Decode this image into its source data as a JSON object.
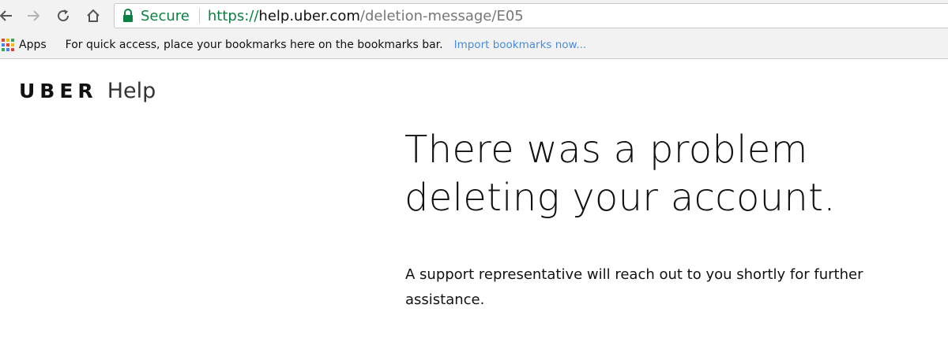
{
  "browser": {
    "secure_label": "Secure",
    "url_scheme": "https://",
    "url_host": "help.uber.com",
    "url_path": "/deletion-message/E05",
    "accent_secure": "#0b8043",
    "icons": {
      "back": "back-arrow-icon",
      "forward": "forward-arrow-icon",
      "reload": "reload-icon",
      "home": "home-icon",
      "lock": "lock-icon"
    }
  },
  "bookmarks_bar": {
    "apps_label": "Apps",
    "quick_access_text": "For quick access, place your bookmarks here on the bookmarks bar.",
    "import_link": "Import bookmarks now...",
    "link_color": "#4a8bd9"
  },
  "page": {
    "brand": "UBER",
    "section": "Help",
    "title_line1": "There was a problem",
    "title_line2": "deleting your account.",
    "body": "A support representative will reach out to you shortly for further assistance."
  }
}
